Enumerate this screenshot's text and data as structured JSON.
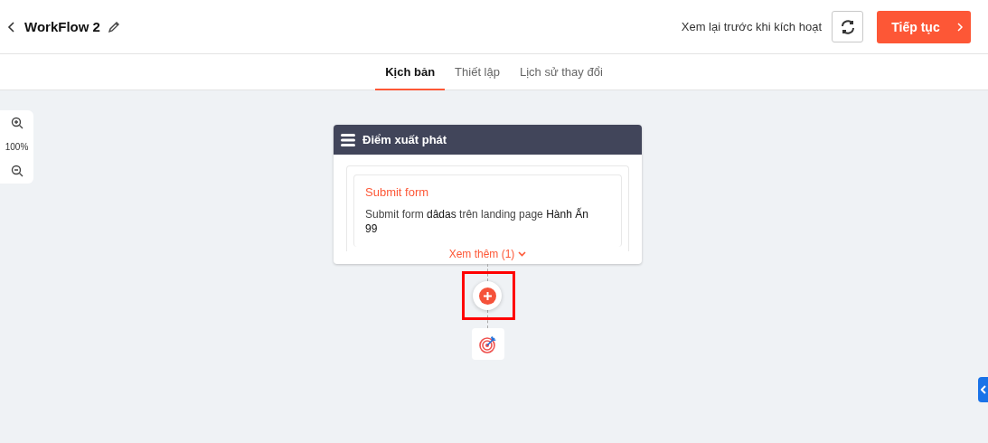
{
  "header": {
    "title": "WorkFlow 2",
    "review_label": "Xem lại trước khi kích hoạt",
    "continue_button": "Tiếp tục"
  },
  "tabs": [
    {
      "label": "Kịch bản",
      "selected": true
    },
    {
      "label": "Thiết lập",
      "selected": false
    },
    {
      "label": "Lịch sử thay đổi",
      "selected": false
    }
  ],
  "zoom": {
    "value": "100%"
  },
  "start_node": {
    "title": "Điểm xuất phát",
    "trigger": {
      "title": "Submit form",
      "description": "Submit form **dâdas** trên landing page **Hành Ấn 99**"
    },
    "more_link": "Xem thêm (1)"
  },
  "add_step": {
    "highlighted": true
  }
}
